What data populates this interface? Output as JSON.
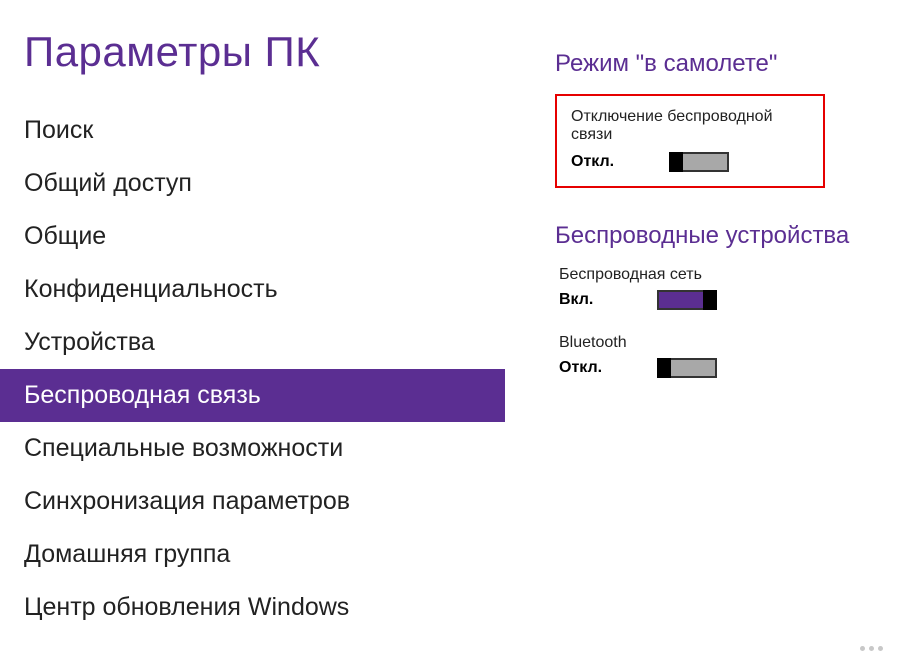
{
  "sidebar": {
    "title": "Параметры ПК",
    "items": [
      {
        "label": "Поиск",
        "selected": false
      },
      {
        "label": "Общий доступ",
        "selected": false
      },
      {
        "label": "Общие",
        "selected": false
      },
      {
        "label": "Конфиденциальность",
        "selected": false
      },
      {
        "label": "Устройства",
        "selected": false
      },
      {
        "label": "Беспроводная связь",
        "selected": true
      },
      {
        "label": "Специальные возможности",
        "selected": false
      },
      {
        "label": "Синхронизация параметров",
        "selected": false
      },
      {
        "label": "Домашняя группа",
        "selected": false
      },
      {
        "label": "Центр обновления Windows",
        "selected": false
      }
    ]
  },
  "content": {
    "airplane": {
      "heading": "Режим \"в самолете\"",
      "label": "Отключение беспроводной связи",
      "state": "Откл.",
      "on": false,
      "highlighted": true
    },
    "devices": {
      "heading": "Беспроводные устройства",
      "items": [
        {
          "label": "Беспроводная сеть",
          "state": "Вкл.",
          "on": true
        },
        {
          "label": "Bluetooth",
          "state": "Откл.",
          "on": false
        }
      ]
    }
  },
  "colors": {
    "accent": "#5b2e92",
    "highlight_border": "#e60000"
  }
}
